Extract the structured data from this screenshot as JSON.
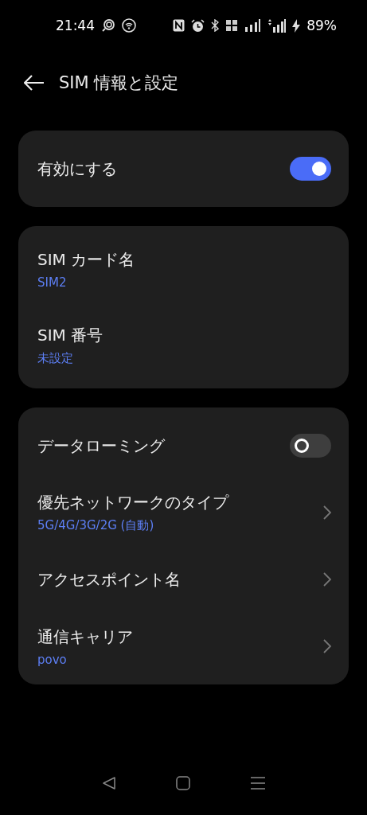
{
  "status_bar": {
    "time": "21:44",
    "battery": "89%"
  },
  "header": {
    "title": "SIM 情報と設定"
  },
  "cards": [
    {
      "rows": [
        {
          "kind": "toggle",
          "label": "有効にする",
          "on": true
        }
      ]
    },
    {
      "rows": [
        {
          "kind": "text",
          "label": "SIM カード名",
          "value": "SIM2"
        },
        {
          "kind": "text",
          "label": "SIM 番号",
          "value": "未設定"
        }
      ]
    },
    {
      "rows": [
        {
          "kind": "toggle",
          "label": "データローミング",
          "on": false
        },
        {
          "kind": "link",
          "label": "優先ネットワークのタイプ",
          "value": "5G/4G/3G/2G (自動)"
        },
        {
          "kind": "link",
          "label": "アクセスポイント名"
        },
        {
          "kind": "link",
          "label": "通信キャリア",
          "value": "povo"
        }
      ]
    }
  ]
}
